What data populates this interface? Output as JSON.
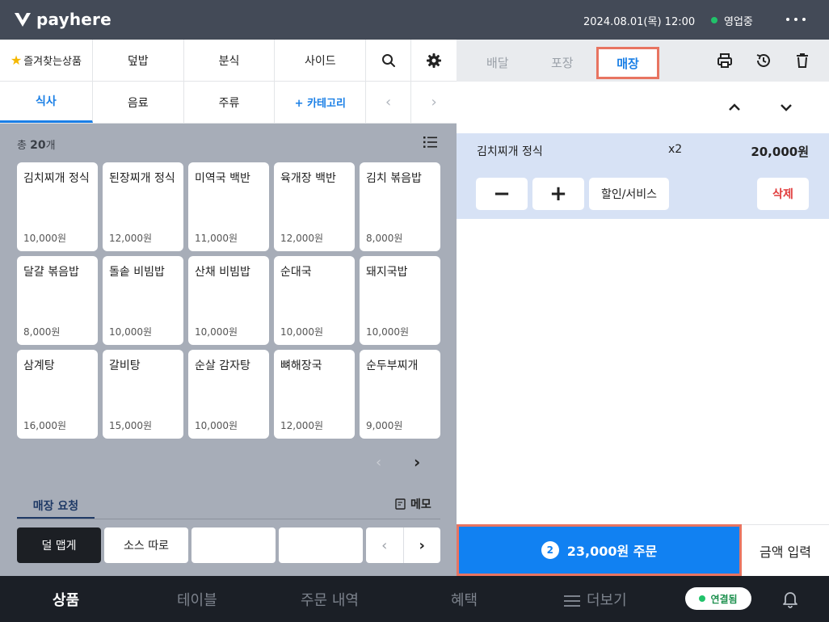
{
  "app": {
    "logo_text": "payhere"
  },
  "topbar": {
    "datetime": "2024.08.01(목) 12:00",
    "status": "영업중",
    "status_color": "#21c26a"
  },
  "categories_row1": [
    "즐겨찾는상품",
    "덮밥",
    "분식",
    "사이드"
  ],
  "categories_row2": [
    "식사",
    "음료",
    "주류",
    "+ 카테고리"
  ],
  "active_category": "식사",
  "product_count": {
    "prefix": "총",
    "number": "20",
    "suffix": "개"
  },
  "products": [
    {
      "name": "김치찌개 정식",
      "price": "10,000원"
    },
    {
      "name": "된장찌개 정식",
      "price": "12,000원"
    },
    {
      "name": "미역국 백반",
      "price": "11,000원"
    },
    {
      "name": "육개장 백반",
      "price": "12,000원"
    },
    {
      "name": "김치 볶음밥",
      "price": "8,000원"
    },
    {
      "name": "달걀 볶음밥",
      "price": "8,000원"
    },
    {
      "name": "돌솥 비빔밥",
      "price": "10,000원"
    },
    {
      "name": "산채 비빔밥",
      "price": "10,000원"
    },
    {
      "name": "순대국",
      "price": "10,000원"
    },
    {
      "name": "돼지국밥",
      "price": "10,000원"
    },
    {
      "name": "삼계탕",
      "price": "16,000원"
    },
    {
      "name": "갈비탕",
      "price": "15,000원"
    },
    {
      "name": "순살 감자탕",
      "price": "10,000원"
    },
    {
      "name": "뼈해장국",
      "price": "12,000원"
    },
    {
      "name": "순두부찌개",
      "price": "9,000원"
    }
  ],
  "requests": {
    "tab_label": "매장 요청",
    "memo_label": "메모",
    "buttons": [
      "덜 맵게",
      "소스 따로",
      "",
      ""
    ]
  },
  "order_tabs": [
    "배달",
    "포장",
    "매장"
  ],
  "active_order_tab": "매장",
  "order_items": [
    {
      "name": "김치찌개 정식",
      "qty": "x2",
      "price": "20,000원"
    }
  ],
  "order_item_actions": {
    "minus": "−",
    "plus": "+",
    "discount": "할인/서비스",
    "delete": "삭제"
  },
  "order_button": {
    "count": "2",
    "label": "23,000원 주문"
  },
  "amount_input": "금액 입력",
  "bottom_nav": [
    "상품",
    "테이블",
    "주문 내역",
    "혜택",
    "더보기"
  ],
  "active_nav": "상품",
  "connection": "연결됨",
  "colors": {
    "accent": "#1181f2",
    "highlight_border": "#e87461",
    "topbar": "#434a57",
    "bottombar": "#1b1f26",
    "delete": "#e03c3c"
  }
}
